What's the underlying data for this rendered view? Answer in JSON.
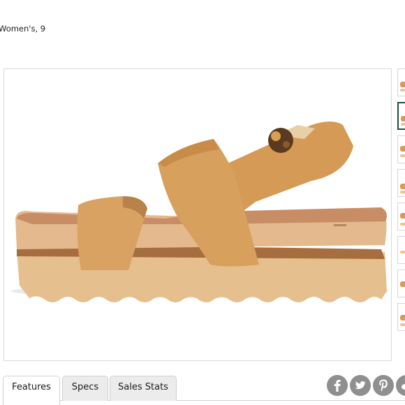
{
  "product": {
    "subtitle": "Women's, 9"
  },
  "gallery": {
    "main_image_icon": "sandal-product-photo",
    "thumbnails": [
      {
        "icon": "sandal-thumbnail",
        "selected": false
      },
      {
        "icon": "sandal-thumbnail",
        "selected": true
      },
      {
        "icon": "sandal-thumbnail",
        "selected": false
      },
      {
        "icon": "sandal-thumbnail",
        "selected": false
      },
      {
        "icon": "sandal-thumbnail",
        "selected": false
      },
      {
        "icon": "sandal-thumbnail",
        "selected": false
      },
      {
        "icon": "sandal-thumbnail",
        "selected": false
      },
      {
        "icon": "sandal-thumbnail",
        "selected": false
      }
    ]
  },
  "tabs": [
    {
      "label": "Features",
      "active": true
    },
    {
      "label": "Specs",
      "active": false
    },
    {
      "label": "Sales Stats",
      "active": false
    }
  ],
  "share": {
    "icons": [
      "facebook-icon",
      "twitter-icon",
      "pinterest-icon",
      "reddit-icon"
    ]
  },
  "colors": {
    "strap": "#d59a55",
    "footbed": "#c98d65",
    "sole": "#e6c49b",
    "selected_border": "#1f4e44",
    "share_icon": "#8f8f8f"
  }
}
